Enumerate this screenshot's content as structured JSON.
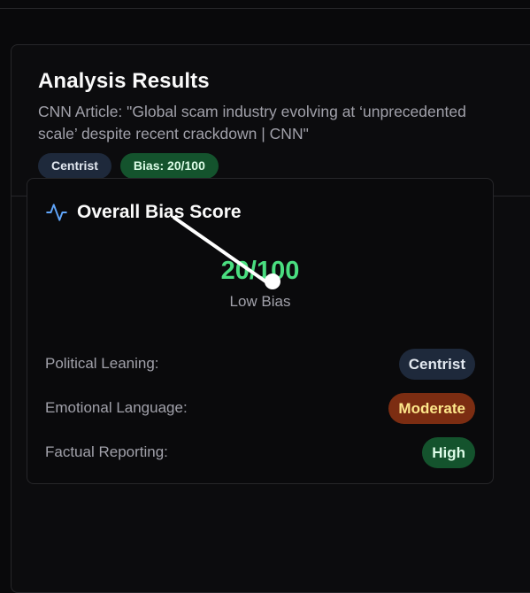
{
  "header": {
    "title": "Analysis Results",
    "subtitle": "CNN Article: \"Global scam industry evolving at ‘unprecedented scale’ despite recent crackdown | CNN\"",
    "badges": [
      "Centrist",
      "Bias: 20/100"
    ]
  },
  "overall": {
    "title": "Overall Bias Score",
    "icon": "activity-icon",
    "score": "20/100",
    "score_label": "Low Bias",
    "score_color": "#4ade80"
  },
  "metrics": [
    {
      "label": "Political Leaning:",
      "value": "Centrist",
      "color": "#1e293b"
    },
    {
      "label": "Emotional Language:",
      "value": "Moderate",
      "color": "#7c2d12"
    },
    {
      "label": "Factual Reporting:",
      "value": "High",
      "color": "#14532d"
    }
  ]
}
